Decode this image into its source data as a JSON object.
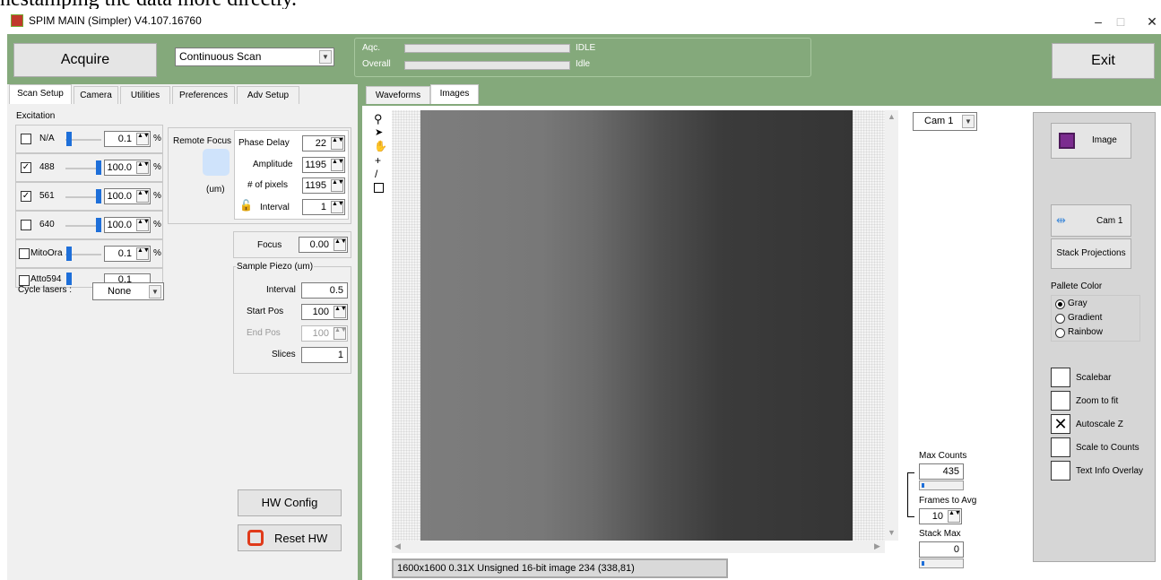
{
  "top_overflow_text": "nestamping the data more directly.",
  "window": {
    "title": "SPIM MAIN (Simpler) V4.107.16760",
    "minimize": "–",
    "maximize": "□",
    "close": "✕"
  },
  "toolbar": {
    "acquire_label": "Acquire",
    "scan_mode_value": "Continuous Scan",
    "exit_label": "Exit",
    "acq_label": "Aqc.",
    "overall_label": "Overall",
    "acq_status": "IDLE",
    "overall_status": "Idle"
  },
  "left_tabs": [
    "Scan Setup",
    "Camera",
    "Utilities",
    "Preferences",
    "Adv Setup"
  ],
  "excitation": {
    "title": "Excitation",
    "lasers": [
      {
        "name": "N/A",
        "checked": false,
        "value": "0.1",
        "unit": "%"
      },
      {
        "name": "488",
        "checked": true,
        "value": "100.0",
        "unit": "%"
      },
      {
        "name": "561",
        "checked": true,
        "value": "100.0",
        "unit": "%"
      },
      {
        "name": "640",
        "checked": false,
        "value": "100.0",
        "unit": "%"
      },
      {
        "name": "MitoOra",
        "checked": false,
        "value": "0.1",
        "unit": "%"
      },
      {
        "name": "Atto594",
        "checked": false,
        "value": "0.1",
        "unit": "%"
      }
    ],
    "cycle_label": "Cycle lasers :",
    "cycle_value": "None"
  },
  "remote_focus": {
    "title": "Remote Focus",
    "unit": "(um)",
    "phase_delay_label": "Phase Delay",
    "phase_delay": "22",
    "amplitude_label": "Amplitude",
    "amplitude": "1195",
    "pixels_label": "# of pixels",
    "pixels": "1195",
    "interval_label": "Interval",
    "interval": "1"
  },
  "focus": {
    "label": "Focus",
    "value": "0.00"
  },
  "sample_piezo": {
    "title": "Sample Piezo (um)",
    "interval_label": "Interval",
    "interval": "0.5",
    "start_label": "Start Pos",
    "start": "100",
    "end_label": "End Pos",
    "end": "100",
    "slices_label": "Slices",
    "slices": "1"
  },
  "hw": {
    "config_label": "HW Config",
    "reset_label": "Reset HW"
  },
  "view_tabs": [
    "Waveforms",
    "Images"
  ],
  "image": {
    "info": "1600x1600 0.31X Unsigned 16-bit image 234   (338,81)",
    "cam_select": "Cam 1",
    "max_counts_label": "Max Counts",
    "max_counts": "435",
    "frames_avg_label": "Frames to Avg",
    "frames_avg": "10",
    "stack_max_label": "Stack Max",
    "stack_max": "0"
  },
  "right_panel": {
    "image_btn": "Image",
    "cam_btn": "Cam 1",
    "stack_proj_btn": "Stack Projections",
    "palette_title": "Pallete Color",
    "palette_options": [
      "Gray",
      "Gradient",
      "Rainbow"
    ],
    "palette_selected": "Gray",
    "toggles": [
      {
        "label": "Scalebar",
        "checked": false
      },
      {
        "label": "Zoom to fit",
        "checked": false
      },
      {
        "label": "Autoscale Z",
        "checked": true
      },
      {
        "label": "Scale to Counts",
        "checked": false
      },
      {
        "label": "Text Info Overlay",
        "checked": false
      }
    ]
  },
  "colors": {
    "green": "#84a97b",
    "accent_blue": "#1e6fd9"
  }
}
